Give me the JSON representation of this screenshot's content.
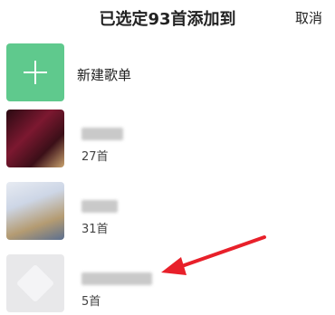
{
  "header": {
    "title": "已选定93首添加到",
    "cancel_label": "取消"
  },
  "new_playlist": {
    "label": "新建歌单"
  },
  "playlists": [
    {
      "count": "27首"
    },
    {
      "count": "31首"
    },
    {
      "count": "5首"
    }
  ],
  "colors": {
    "new_tile": "#5fc98d",
    "arrow": "#e8202a"
  }
}
